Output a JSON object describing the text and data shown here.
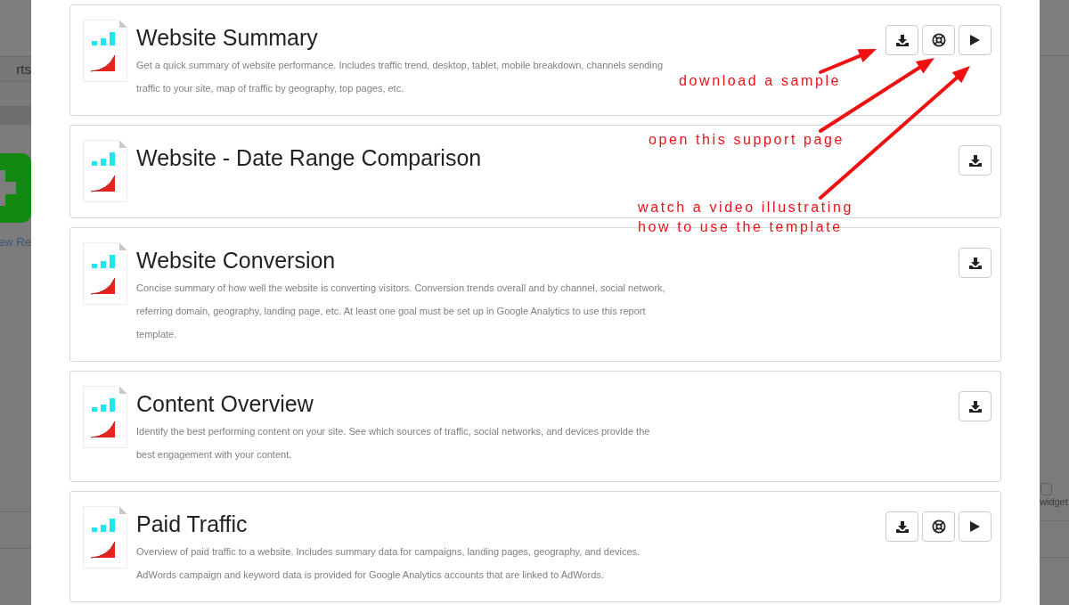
{
  "page_behind": {
    "nav_tab": "rts",
    "new_report_label": "ew Re",
    "widget_label": "widget"
  },
  "templates": [
    {
      "title": "Website Summary",
      "description": "Get a quick summary of website performance. Includes traffic trend, desktop, tablet, mobile breakdown, channels sending traffic to your site, map of traffic by geography, top pages, etc.",
      "actions": [
        {
          "kind": "download"
        },
        {
          "kind": "support"
        },
        {
          "kind": "video"
        }
      ]
    },
    {
      "title": "Website - Date Range Comparison",
      "actions": [
        {
          "kind": "download"
        }
      ]
    },
    {
      "title": "Website Conversion",
      "description": "Concise summary of how well the website is converting visitors. Conversion trends overall and by channel, social network, referring domain, geography, landing page, etc. At least one goal must be set up in Google Analytics to use this report template.",
      "actions": [
        {
          "kind": "download"
        }
      ]
    },
    {
      "title": "Content Overview",
      "description": "Identify the best performing content on your site. See which sources of traffic, social networks, and devices provide the best engagement with your content.",
      "actions": [
        {
          "kind": "download"
        }
      ]
    },
    {
      "title": "Paid Traffic",
      "description": "Overview of paid traffic to a website. Includes summary data for campaigns, landing pages, geography, and devices. AdWords campaign and keyword data is provided for Google Analytics accounts that are linked to AdWords.",
      "actions": [
        {
          "kind": "download"
        },
        {
          "kind": "support"
        },
        {
          "kind": "video"
        }
      ]
    }
  ],
  "annotations": [
    {
      "lines": [
        "download a sample"
      ]
    },
    {
      "lines": [
        "open this support page"
      ]
    },
    {
      "lines": [
        "watch a video illustrating",
        "how to use the template"
      ]
    }
  ]
}
